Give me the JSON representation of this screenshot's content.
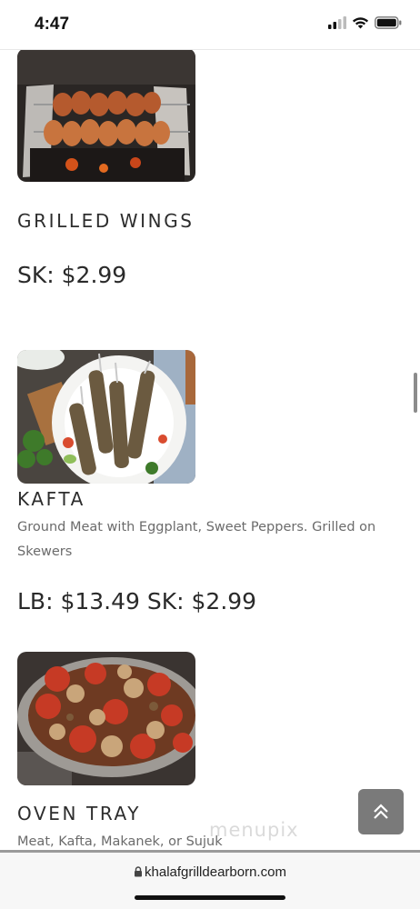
{
  "status": {
    "time": "4:47"
  },
  "menu": {
    "items": [
      {
        "title": "GRILLED WINGS",
        "description": "",
        "price": "SK: $2.99",
        "image": "grilled-wings-photo"
      },
      {
        "title": "KAFTA",
        "description": "Ground Meat with Eggplant, Sweet Peppers. Grilled on Skewers",
        "price": "LB: $13.49 SK: $2.99",
        "image": "kafta-photo"
      },
      {
        "title": "OVEN TRAY",
        "description": "Meat, Kafta, Makanek, or Sujuk",
        "price": "",
        "image": "oven-tray-photo"
      }
    ]
  },
  "watermark": "menupix",
  "browser": {
    "url": "khalafgrilldearborn.com"
  },
  "colors": {
    "accent": "#7a7a7a",
    "text": "#2a2a2a",
    "muted": "#6b6b6b"
  }
}
